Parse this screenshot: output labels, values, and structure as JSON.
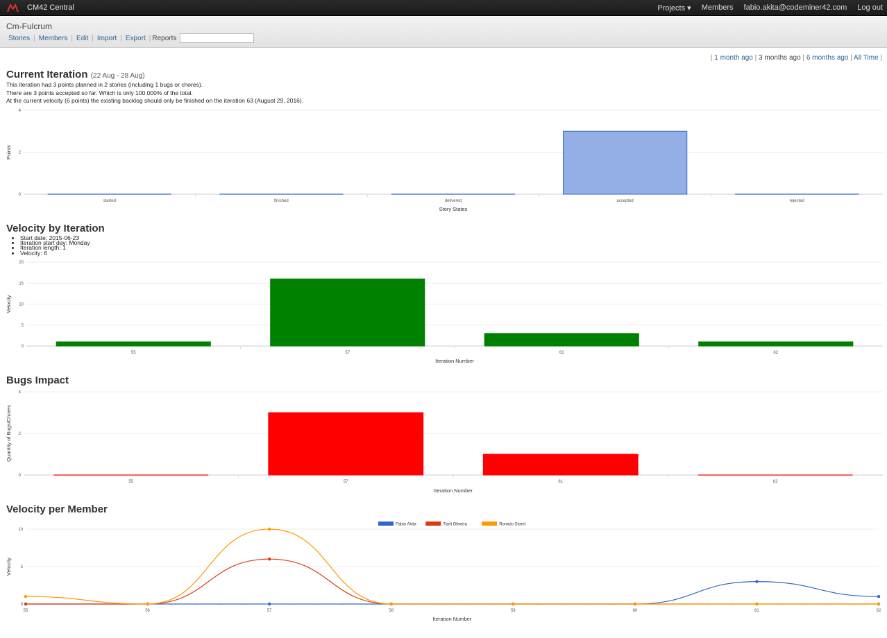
{
  "navbar": {
    "brand": "CM42 Central",
    "projects_label": "Projects ▾",
    "members_label": "Members",
    "user_email": "fabio.akita@codeminer42.com",
    "logout_label": "Log out"
  },
  "project": {
    "title": "Cm-Fulcrum",
    "tabs": [
      "Stories",
      "Members",
      "Edit",
      "Import",
      "Export"
    ],
    "reports_label": "Reports",
    "search_value": ""
  },
  "range": {
    "leading_sep": "|",
    "one_month": "1 month ago",
    "three_months": "3 months ago",
    "six_months": "6 months ago",
    "all_time": "All Time",
    "trailing_sep": "|"
  },
  "current_iteration": {
    "title": "Current Iteration",
    "dates": "(22 Aug - 28 Aug)",
    "line1": "This iteration had 3 points planned in 2 stories (including 1 bugs or chores).",
    "line2": "There are 3 points accepted so far. Which is only 100.000% of the total.",
    "line3": "At the current velocity (6 points) the existing backlog should only be finished on the iteration 63 (August 29, 2016)."
  },
  "velocity_section": {
    "title": "Velocity by Iteration",
    "info": [
      "Start date: 2015-06-23",
      "Iteration start day: Monday",
      "Iteration length: 1",
      "Velocity: 6"
    ]
  },
  "bugs_section": {
    "title": "Bugs Impact"
  },
  "member_section": {
    "title": "Velocity per Member"
  },
  "chart_data": [
    {
      "type": "bar",
      "categories": [
        "started",
        "finished",
        "delivered",
        "accepted",
        "rejected"
      ],
      "values": [
        0,
        0,
        0,
        3,
        0
      ],
      "xlabel": "Story States",
      "ylabel": "Points",
      "ylim": [
        0,
        4
      ],
      "yticks": [
        0,
        2,
        4
      ],
      "color": "#3366cc",
      "fill": "#94aee6",
      "grid": true
    },
    {
      "type": "bar",
      "categories": [
        "55",
        "57",
        "61",
        "62"
      ],
      "values": [
        1,
        16,
        3,
        1
      ],
      "xlabel": "Iteration Number",
      "ylabel": "Velocity",
      "ylim": [
        0,
        20
      ],
      "yticks": [
        0,
        5,
        10,
        15,
        20
      ],
      "color": "#008000",
      "fill": "#008000",
      "grid": true
    },
    {
      "type": "bar",
      "categories": [
        "55",
        "57",
        "61",
        "62"
      ],
      "values": [
        0,
        3,
        1,
        0
      ],
      "xlabel": "Iteration Number",
      "ylabel": "Quantity of Bugs/Chores",
      "ylim": [
        0,
        4
      ],
      "yticks": [
        0,
        2,
        4
      ],
      "color": "#ff0000",
      "fill": "#ff0000",
      "grid": true
    },
    {
      "type": "line",
      "x": [
        55,
        56,
        57,
        58,
        59,
        60,
        61,
        62
      ],
      "series": [
        {
          "name": "Fabio Akita",
          "color": "#3366cc",
          "values": [
            0,
            0,
            0,
            0,
            0,
            0,
            3,
            1
          ]
        },
        {
          "name": "Tiarli Oliveira",
          "color": "#dc3912",
          "values": [
            0,
            0,
            6,
            0,
            0,
            0,
            0,
            0
          ]
        },
        {
          "name": "Romulo Storel",
          "color": "#ff9900",
          "values": [
            1,
            0,
            10,
            0,
            0,
            0,
            0,
            0
          ]
        }
      ],
      "xlabel": "Iteration Number",
      "ylabel": "Velocity",
      "ylim": [
        0,
        10
      ],
      "yticks": [
        0,
        5,
        10
      ],
      "legend": "top",
      "grid": true
    }
  ]
}
